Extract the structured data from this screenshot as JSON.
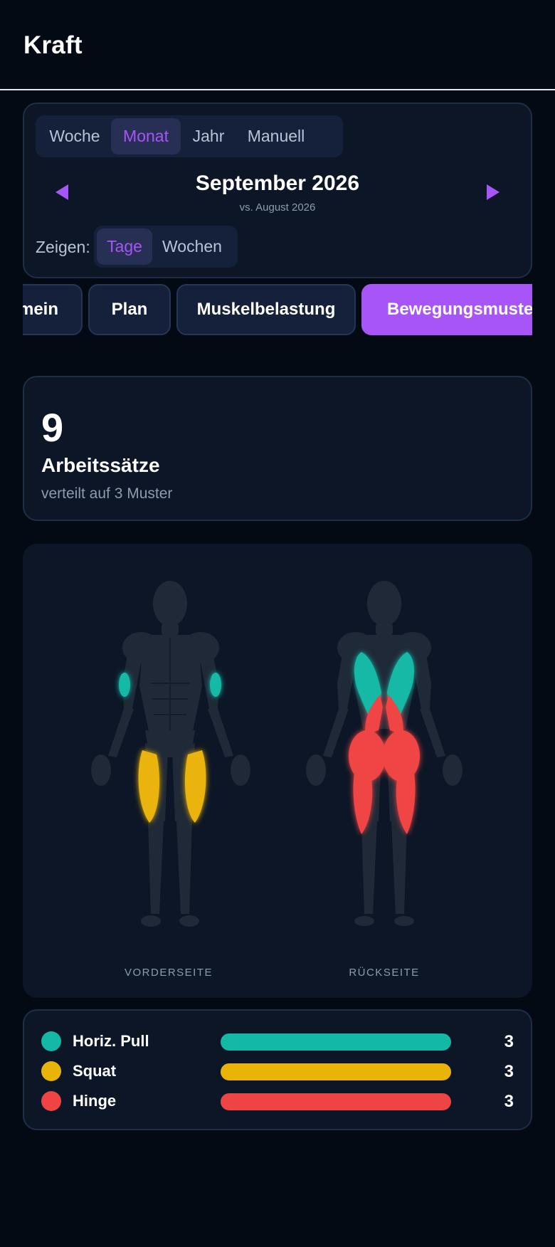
{
  "header": {
    "title": "Kraft"
  },
  "period": {
    "options": [
      "Woche",
      "Monat",
      "Jahr",
      "Manuell"
    ],
    "selected": "Monat",
    "month_label": "September 2026",
    "comparison": "vs. August 2026",
    "show_label": "Zeigen:",
    "show_options": [
      "Tage",
      "Wochen"
    ],
    "show_selected": "Tage"
  },
  "tabs": {
    "items": [
      "Allgemein",
      "Plan",
      "Muskelbelastung",
      "Bewegungsmuster"
    ],
    "visible_first": "mein",
    "active": "Bewegungsmuster"
  },
  "summary": {
    "value": "9",
    "label": "Arbeitssätze",
    "sub": "verteilt auf 3 Muster"
  },
  "body_map": {
    "front_label": "VORDERSEITE",
    "back_label": "RÜCKSEITE"
  },
  "legend": [
    {
      "name": "Horiz. Pull",
      "value": "3",
      "fill_fraction": 1.0,
      "color": "#14b8a6",
      "muscles": [
        "biceps",
        "lats"
      ]
    },
    {
      "name": "Squat",
      "value": "3",
      "fill_fraction": 1.0,
      "color": "#eab308",
      "muscles": [
        "quadriceps"
      ]
    },
    {
      "name": "Hinge",
      "value": "3",
      "fill_fraction": 1.0,
      "color": "#ef4444",
      "muscles": [
        "glutes",
        "hamstrings"
      ]
    }
  ],
  "colors": {
    "accent": "#a855f7",
    "background": "#040a14",
    "card": "#0c1626",
    "body_base": "#1f2937"
  }
}
